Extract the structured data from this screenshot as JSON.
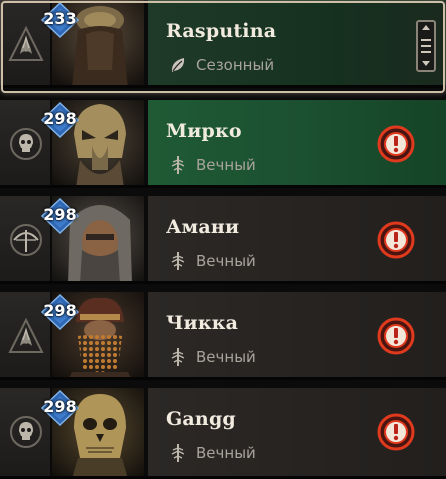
{
  "characters": [
    {
      "name": "Rasputina",
      "level": "233",
      "realm": "Сезонный",
      "realm_icon": "leaf-icon",
      "class_icon": "druid-icon",
      "selected": true,
      "action": "reorder-handle-icon"
    },
    {
      "name": "Мирко",
      "level": "298",
      "realm": "Вечный",
      "realm_icon": "eternal-sword-icon",
      "class_icon": "necromancer-skull-icon",
      "highlighted": true,
      "action": "warning-icon"
    },
    {
      "name": "Амани",
      "level": "298",
      "realm": "Вечный",
      "realm_icon": "eternal-sword-icon",
      "class_icon": "rogue-bow-icon",
      "action": "warning-icon"
    },
    {
      "name": "Чикка",
      "level": "298",
      "realm": "Вечный",
      "realm_icon": "eternal-sword-icon",
      "class_icon": "druid-icon",
      "action": "warning-icon"
    },
    {
      "name": "Gangg",
      "level": "298",
      "realm": "Вечный",
      "realm_icon": "eternal-sword-icon",
      "class_icon": "necromancer-skull-icon",
      "action": "warning-icon"
    }
  ],
  "colors": {
    "selected_row_bg": "#163120",
    "highlighted_row_bg": "#1b4f30",
    "default_row_bg": "#221f1d",
    "badge_blue": "#2f67b3",
    "warning_red": "#e03a1e"
  }
}
